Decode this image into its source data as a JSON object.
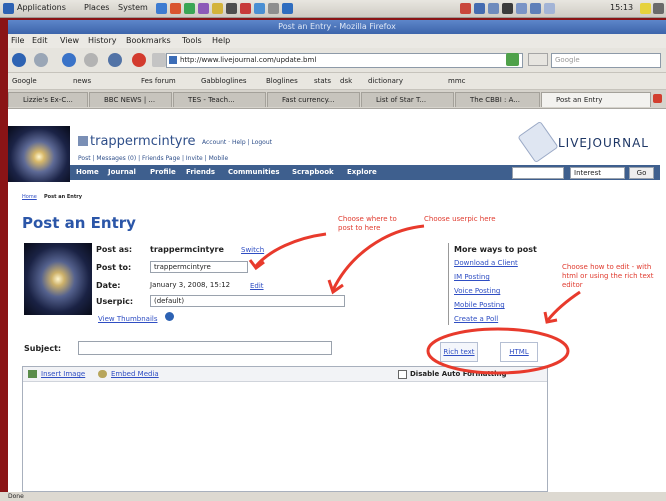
{
  "panel": {
    "menus": [
      "Applications",
      "Places",
      "System"
    ],
    "clock": "15:13"
  },
  "window": {
    "title": "Post an Entry - Mozilla Firefox"
  },
  "menubar": [
    "File",
    "Edit",
    "View",
    "History",
    "Bookmarks",
    "Tools",
    "Help"
  ],
  "navbar": {
    "url": "http://www.livejournal.com/update.bml",
    "search_placeholder": "Google"
  },
  "bookmarks": [
    "Google",
    "news",
    "Fes forum",
    "Gabbloglines",
    "Bloglines",
    "stats",
    "dsk",
    "dictionary",
    "mmc"
  ],
  "tabs": [
    "Lizzie's Ex-C...",
    "BBC NEWS | ...",
    "TES - Teach...",
    "Fast currency...",
    "List of Star T...",
    "The CBBI : A...",
    "Post an Entry"
  ],
  "lj": {
    "username": "trappermcintyre",
    "account_links": "Account · Help | Logout",
    "sublinks": "Post | Messages (0) | Friends Page | Invite | Mobile",
    "logo": "LIVEJOURNAL",
    "nav": [
      "Home",
      "Journal",
      "Profile",
      "Friends",
      "Communities",
      "Scrapbook",
      "Explore"
    ],
    "search_select": "Interest",
    "go": "Go",
    "breadcrumb_home": "Home",
    "breadcrumb_current": "Post an Entry",
    "page_title": "Post an Entry",
    "post_as_label": "Post as:",
    "post_as_value": "trappermcintyre",
    "switch": "Switch",
    "post_to_label": "Post to:",
    "post_to_value": "trappermcintyre",
    "date_label": "Date:",
    "date_value": "January 3, 2008, 15:12",
    "edit": "Edit",
    "userpic_label": "Userpic:",
    "userpic_value": "(default)",
    "view_thumbnails": "View Thumbnails",
    "more_ways_title": "More ways to post",
    "more_ways": [
      "Download a Client",
      "IM Posting",
      "Voice Posting",
      "Mobile Posting",
      "Create a Poll"
    ],
    "subject_label": "Subject:",
    "rich_text": "Rich text",
    "html": "HTML",
    "insert_image": "Insert Image",
    "embed_media": "Embed Media",
    "disable_auto_format": "Disable Auto Formatting"
  },
  "annotations": {
    "choose_where": "Choose where to post to here",
    "choose_userpic": "Choose userpic here",
    "choose_edit": "Choose how to edit - with html or using the rich text editor"
  },
  "status_bar": "Done"
}
